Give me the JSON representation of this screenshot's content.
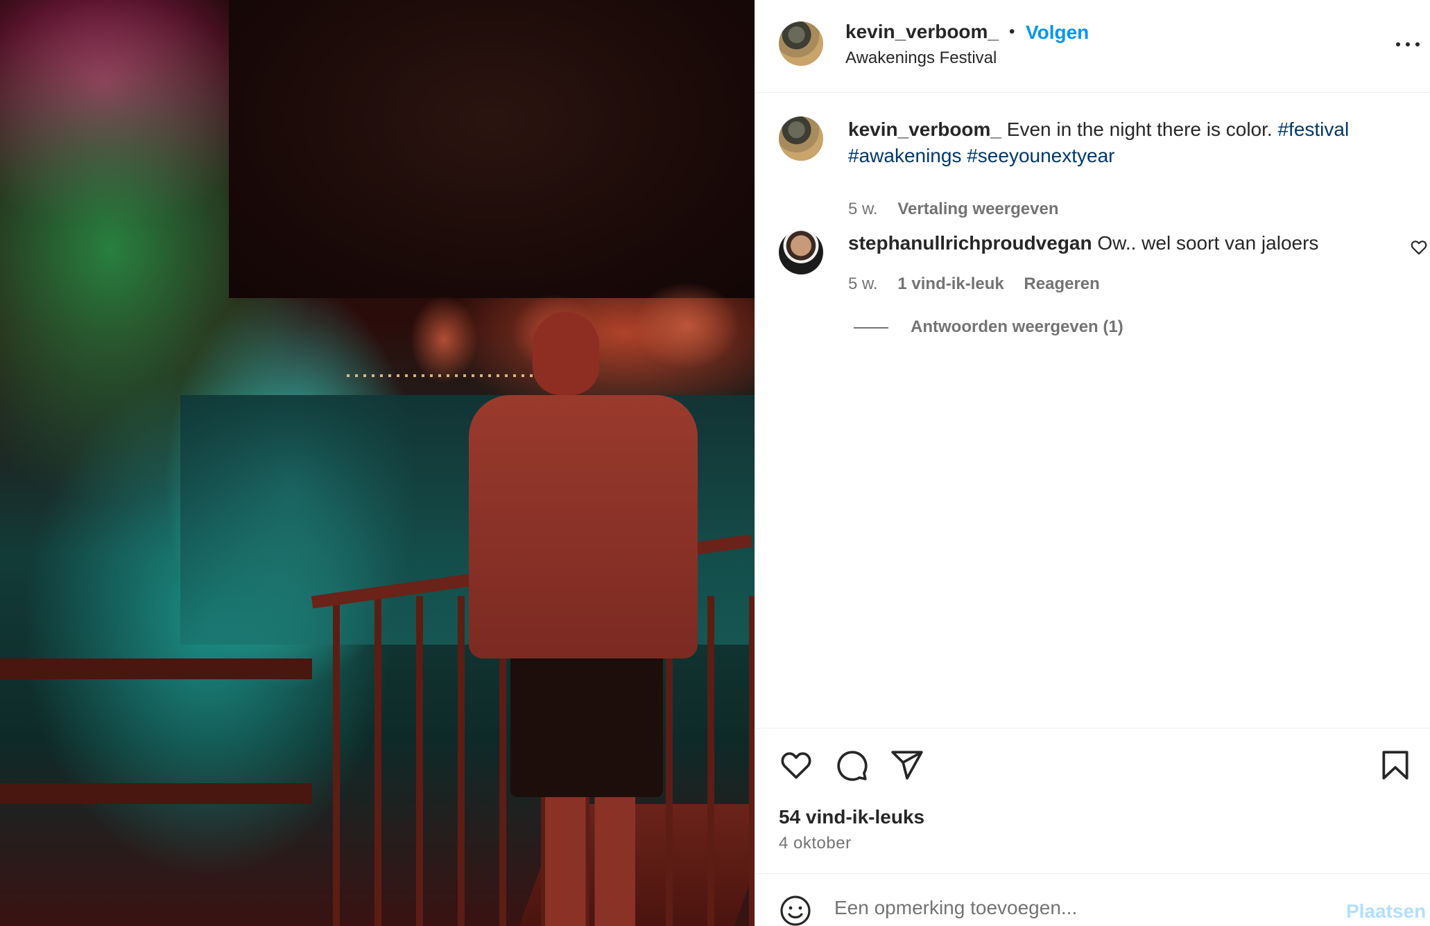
{
  "post": {
    "username": "kevin_verboom_",
    "follow_label": "Volgen",
    "location": "Awakenings Festival"
  },
  "caption": {
    "username": "kevin_verboom_",
    "text": "Even in the night there is color.",
    "hashtags": [
      "#festival",
      "#awakenings",
      "#seeyounextyear"
    ],
    "time": "5 w.",
    "translate_label": "Vertaling weergeven"
  },
  "comment": {
    "username": "stephanullrichproudvegan",
    "text": "Ow.. wel soort van jaloers",
    "time": "5 w.",
    "likes": "1 vind-ik-leuk",
    "reply_label": "Reageren",
    "view_replies_label": "Antwoorden weergeven (1)"
  },
  "actions": {
    "likes_count": "54 vind-ik-leuks",
    "date": "4 oktober",
    "icons": [
      "heart-icon",
      "comment-icon",
      "share-icon",
      "bookmark-icon"
    ]
  },
  "add_comment": {
    "placeholder": "Een opmerking toevoegen...",
    "post_label": "Plaatsen"
  },
  "colors": {
    "link_blue": "#0095f6",
    "hashtag": "#00376b",
    "muted": "#737373",
    "post_disabled": "#b2dffc"
  }
}
